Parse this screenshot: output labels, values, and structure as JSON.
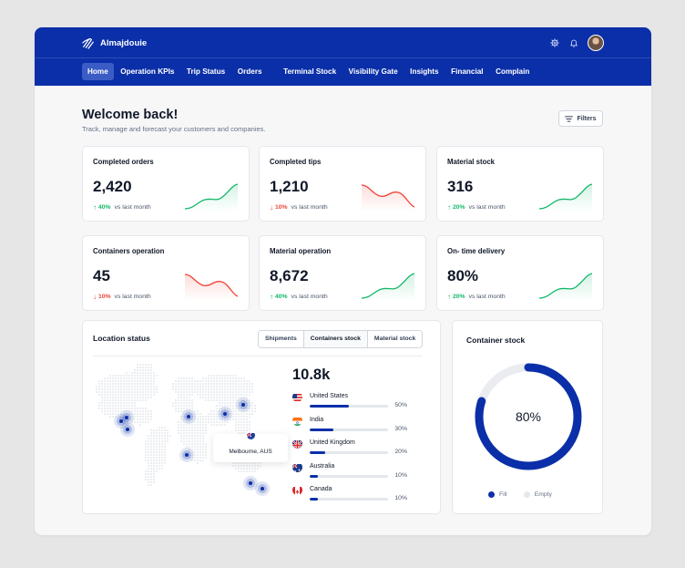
{
  "app": {
    "name": "Almajdouie"
  },
  "nav": {
    "tabs": [
      "Home",
      "Operation KPIs",
      "Trip Status",
      "Orders",
      "Terminal Stock",
      "Visibility Gate",
      "Insights",
      "Financial",
      "Complain"
    ],
    "active": "Home"
  },
  "page": {
    "title": "Welcome back!",
    "subtitle": "Track, manage and forecast your customers and companies.",
    "filters_label": "Filters"
  },
  "kpis": [
    {
      "title": "Completed orders",
      "value": "2,420",
      "change": "40%",
      "direction": "up",
      "compare": "vs last month"
    },
    {
      "title": "Completed tips",
      "value": "1,210",
      "change": "10%",
      "direction": "down",
      "compare": "vs last month"
    },
    {
      "title": "Material stock",
      "value": "316",
      "change": "20%",
      "direction": "up",
      "compare": "vs last month"
    },
    {
      "title": "Containers operation",
      "value": "45",
      "change": "10%",
      "direction": "down",
      "compare": "vs last month"
    },
    {
      "title": "Material operation",
      "value": "8,672",
      "change": "40%",
      "direction": "up",
      "compare": "vs last month"
    },
    {
      "title": "On- time delivery",
      "value": "80%",
      "change": "20%",
      "direction": "up",
      "compare": "vs last month"
    }
  ],
  "location": {
    "title": "Location status",
    "tabs": [
      "Shipments",
      "Containers stock",
      "Material stock"
    ],
    "active_tab": "Containers stock",
    "total": "10.8k",
    "countries": [
      {
        "name": "United States",
        "percent": "50%",
        "fraction": 0.5,
        "flag": "us"
      },
      {
        "name": "India",
        "percent": "30%",
        "fraction": 0.3,
        "flag": "in"
      },
      {
        "name": "United Kingdom",
        "percent": "20%",
        "fraction": 0.2,
        "flag": "uk"
      },
      {
        "name": "Australia",
        "percent": "10%",
        "fraction": 0.1,
        "flag": "au"
      },
      {
        "name": "Canada",
        "percent": "10%",
        "fraction": 0.1,
        "flag": "ca"
      }
    ],
    "tooltip": "Melbourne, AUS"
  },
  "container_stock": {
    "title": "Container stock",
    "percent_label": "80%",
    "fill_fraction": 0.8,
    "legend": [
      "Fill",
      "Empty"
    ]
  },
  "colors": {
    "brand": "#0a2fa8",
    "up": "#12b76a",
    "down": "#f04438"
  }
}
